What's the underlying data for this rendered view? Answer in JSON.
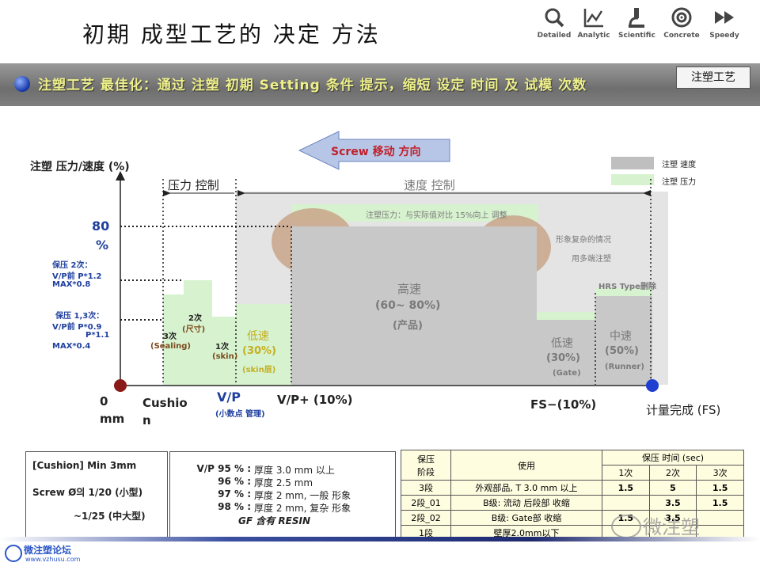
{
  "page": {
    "title": "初期 成型工艺的 决定 方法",
    "badge": "注塑工艺",
    "banner": "注塑工艺 最佳化：通过 注塑 初期 Setting 条件 提示，缩短 设定 时间 及 试模 次数"
  },
  "toolbar": [
    {
      "label": "Detailed",
      "icon": "search-icon"
    },
    {
      "label": "Analytic",
      "icon": "chart-icon"
    },
    {
      "label": "Scientific",
      "icon": "microscope-icon"
    },
    {
      "label": "Concrete",
      "icon": "target-icon"
    },
    {
      "label": "Speedy",
      "icon": "fast-forward-icon"
    }
  ],
  "diagram": {
    "direction": "Screw 移动 方向",
    "y_axis_title": "注塑 压力/速度 (%)",
    "y_80": "80",
    "y_80_unit": "%",
    "pressure_control": "压力 控制",
    "speed_control": "速度 控制",
    "legend": [
      {
        "label": "注塑 速度",
        "color": "#bfbfbf"
      },
      {
        "label": "注塑 压力",
        "color": "#d7f2cf"
      }
    ],
    "pressure_note": "注塑压力：与实际值对比 15%向上 调整",
    "complex_note_1": "形象复杂的情况",
    "complex_note_2": "用多端注塑",
    "hrs_note": "HRS Type删除",
    "hold2_1": "保压 2次：",
    "hold2_2": "V/P前 P*1.2",
    "hold2_3": "MAX*0.8",
    "hold13_1": "保压 1,3次：",
    "hold13_2": "V/P前 P*0.9",
    "hold13_3": "P*1.1",
    "hold13_4": "MAX*0.4",
    "stage3": "3次",
    "stage3_sub": "(Sealing)",
    "stage2": "2次",
    "stage2_sub": "(尺寸)",
    "stage1": "1次",
    "stage1_sub": "(skin)",
    "low1": "低速",
    "low1_pct": "(30%)",
    "low1_sub": "(skin层)",
    "high": "高速",
    "high_pct": "(60~ 80%)",
    "high_sub": "(产品)",
    "low2": "低速",
    "low2_pct": "(30%)",
    "low2_sub": "(Gate)",
    "mid": "中速",
    "mid_pct": "(50%)",
    "mid_sub": "(Runner)",
    "x0": "0",
    "x0_unit": "mm",
    "cushion_1": "Cushio",
    "cushion_2": "n",
    "vp": "V/P",
    "vp_sub": "(小数点 管理)",
    "vp_plus": "V/P+ (10%)",
    "fs_minus": "FS−(10%)",
    "fs": "计量完成 (FS)"
  },
  "notes_left": {
    "line1": "[Cushion] Min 3mm",
    "line2": "Screw Ø의  1/20 (小型)",
    "line3": "~1/25  (中大型)"
  },
  "notes_mid": [
    {
      "pct": "V/P 95 % :",
      "text": "厚度 3.0 mm 以上"
    },
    {
      "pct": "96 % :",
      "text": "厚度 2.5 mm"
    },
    {
      "pct": "97 % :",
      "text": "厚度 2 mm, 一般 形象"
    },
    {
      "pct": "98 % :",
      "text": "厚度 2 mm, 复杂 形象"
    },
    {
      "pct": "",
      "text": "GF 含有 RESIN"
    }
  ],
  "table": {
    "h_stage": "保压\n阶段",
    "h_stage_1": "保压",
    "h_stage_2": "阶段",
    "h_use": "使用",
    "h_time": "保压 时间 (sec)",
    "h_c1": "1次",
    "h_c2": "2次",
    "h_c3": "3次",
    "rows": [
      {
        "stage": "3段",
        "use": "外观部品, T 3.0 mm 以上",
        "c1": "1.5",
        "c2": "5",
        "c3": "1.5"
      },
      {
        "stage": "2段_01",
        "use": "B级: 流动 后段部 收缩",
        "c1": "",
        "c2": "3.5",
        "c3": "1.5"
      },
      {
        "stage": "2段_02",
        "use": "B级: Gate部 收缩",
        "c1": "1.5",
        "c2": "3.5",
        "c3": ""
      },
      {
        "stage": "1段",
        "use": "壁厚2.0mm以下",
        "c1": "",
        "c2": "",
        "c3": ""
      }
    ]
  },
  "watermark": {
    "right": "微注塑",
    "left": "微注塑论坛",
    "left_url": "www.vzhusu.com"
  }
}
